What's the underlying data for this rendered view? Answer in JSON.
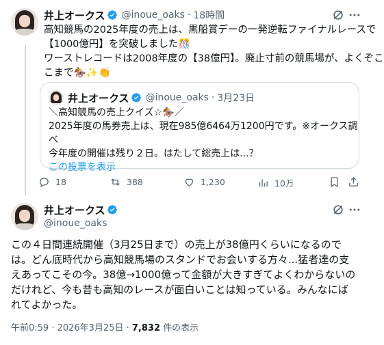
{
  "tweet1": {
    "author_name": "井上オークス",
    "handle": "@inoue_oaks",
    "time": "18時間",
    "lines": [
      "高知競馬の2025年度の売上は、黒船賞デーの一発逆転ファイナルレースで",
      "【1000億円】を突破しました🎊",
      "ワーストレコードは2008年度の【38億円】。廃止寸前の競馬場が、よくぞこ",
      "こまで🏇✨👏"
    ]
  },
  "quote": {
    "author_name": "井上オークス",
    "handle": "@inoue_oaks",
    "date": "3月23日",
    "lines": [
      "＼高知競馬の売上クイズ☆🏇／",
      "2025年度の馬券売上は、現在985億6464万1200円です。※オークス調べ",
      "今年度の開催は残り２日。はたして総売上は...？"
    ],
    "show_poll": "この投票を表示"
  },
  "actions": {
    "replies": "18",
    "reposts": "388",
    "likes": "1,230",
    "views": "10万"
  },
  "tweet2": {
    "author_name": "井上オークス",
    "handle": "@inoue_oaks",
    "lines": [
      "この４日間連続開催（3月25日まで）の売上が38億円くらいになるので",
      "は。どん底時代から高知競馬場のスタンドでお会いする方々...猛者達の支",
      "えあってこその今。38億→1000億って金額が大きすぎてよくわからないの",
      "だけれど、今も昔も高知のレースが面白いことは知っている。みんなにば",
      "れてよかった。"
    ],
    "timestamp": "午前0:59 · 2026年3月25日 · ",
    "views_count": "7,832",
    "views_label": " 件の表示"
  },
  "colors": {
    "accent": "#1d9bf0",
    "secondary_text": "#536471",
    "border": "#cfd9de"
  }
}
